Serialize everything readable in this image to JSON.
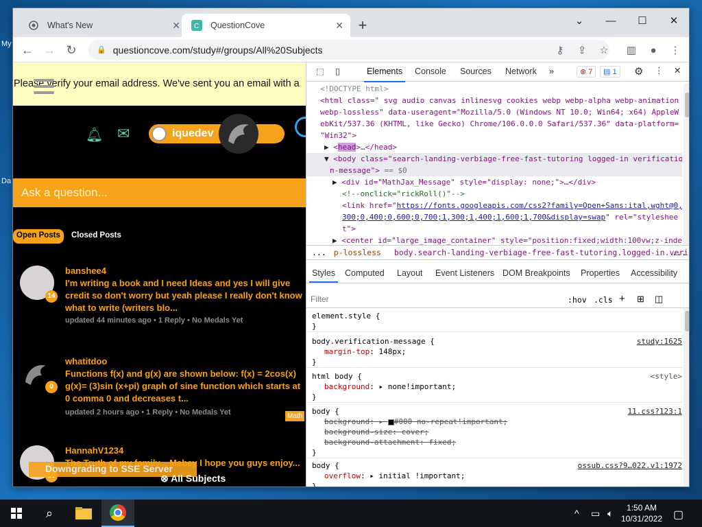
{
  "desktop": {
    "labels": [
      "My",
      "Da"
    ]
  },
  "browser": {
    "tabs": [
      {
        "title": "What's New"
      },
      {
        "title": "QuestionCove"
      }
    ],
    "url": "questioncove.com/study#/groups/All%20Subjects"
  },
  "page": {
    "verify_banner": "Please verify your email address. We've sent you an email with a",
    "username": "iquedev",
    "ask_placeholder": "Ask a question...",
    "filters": {
      "open": "Open Posts",
      "closed": "Closed Posts"
    },
    "posts": [
      {
        "user": "banshee4",
        "badge": "14",
        "question": "I'm writing a book and I need Ideas and yes I will give credit so don't worry but yeah please I really don't know what to write (writers blo...",
        "meta": "updated 44 minutes ago  •  1 Reply  •  No Medals Yet"
      },
      {
        "user": "whatitdoo",
        "badge": "0",
        "question": "Functions f(x) and g(x) are shown below: f(x) = 2cos(x) g(x)= (3)sin (x+pi) graph of sine function which starts at 0 comma 0 and decreases t...",
        "meta": "updated 2 hours ago  •  1 Reply  •  No Medals Yet",
        "tag": "Math"
      },
      {
        "user": "HannahV1234",
        "badge": "16",
        "question": "The Truth of my family... Mabey I hope you guys enjoy..."
      }
    ],
    "sse_banner": "Downgrading to SSE Server",
    "all_subjects": "All Subjects"
  },
  "devtools": {
    "tabs": [
      "Elements",
      "Console",
      "Sources",
      "Network"
    ],
    "more": "»",
    "error_count": "7",
    "message_count": "1",
    "dom": {
      "doctype": "<!DOCTYPE html>",
      "html_open_1": "<html class=\" svg audio canvas inlinesvg cookies webp webp-alpha webp-animation",
      "html_open_2": "webp-lossless\" data-useragent=\"Mozilla/5.0 (Windows NT 10.0; Win64; x64) AppleW",
      "html_open_3": "ebKit/537.36 (KHTML, like Gecko) Chrome/106.0.0.0 Safari/537.36\" data-platform=",
      "html_open_4": "\"Win32\">",
      "head_tag": "head",
      "head_close": "…</head>",
      "body_1": "<body class=\"search-landing-verbiage-free-fast-tutoring logged-in verificatio",
      "body_2": "n-message\">",
      "body_eq": "== $0",
      "div_math": "<div id=\"MathJax_Message\" style=\"display: none;\">…</div>",
      "comment": "<!--onclick=\"rickRoll()\"-->",
      "link_1_pre": "<link href=\"",
      "link_1_url": "https://fonts.googleapis.com/css2?family=Open+Sans:ital,wght@0,",
      "link_2_url": "300;0,400;0,600;0,700;1,300;1,400;1,600;1,700&display=swap",
      "link_2_post": "\" rel=\"styleshee",
      "link_3": "t\">",
      "center": "<center id=\"large_image_container\" style=\"position:fixed;width:100vw;z-inde"
    },
    "breadcrumb": {
      "ellipsis": "...",
      "prev": "p-lossless",
      "current": "body.search-landing-verbiage-free-fast-tutoring.logged-in.verification-message",
      "more": "..."
    },
    "styles_tabs": [
      "Styles",
      "Computed",
      "Layout",
      "Event Listeners",
      "DOM Breakpoints",
      "Properties",
      "Accessibility"
    ],
    "filter_placeholder": "Filter",
    "filter_tools": {
      "hov": ":hov",
      "cls": ".cls",
      "plus": "+"
    },
    "rules": [
      {
        "selector": "element.style {",
        "props": [],
        "source": ""
      },
      {
        "selector": "body.verification-message {",
        "props": [
          {
            "name": "margin-top",
            "value": "148px;"
          }
        ],
        "source": "study:1625"
      },
      {
        "selector": "html body {",
        "props": [
          {
            "name": "background",
            "value": "none!important;"
          }
        ],
        "source": "<style>"
      },
      {
        "selector": "body {",
        "props": [
          {
            "name": "background",
            "value": "#000 no-repeat!important;"
          },
          {
            "name": "background-size",
            "value": "cover;"
          },
          {
            "name": "background-attachment",
            "value": "fixed;"
          }
        ],
        "source": "11.css?123:1"
      },
      {
        "selector": "body {",
        "props": [
          {
            "name": "overflow",
            "value": "initial !important;"
          }
        ],
        "source": "ossub.css?9…022.v1:1972"
      }
    ]
  },
  "taskbar": {
    "time": "1:50 AM",
    "date": "10/31/2022"
  },
  "colors": {
    "accent": "#f7a21b",
    "devtools_accent": "#1a73e8",
    "teal": "#52d0b0"
  }
}
